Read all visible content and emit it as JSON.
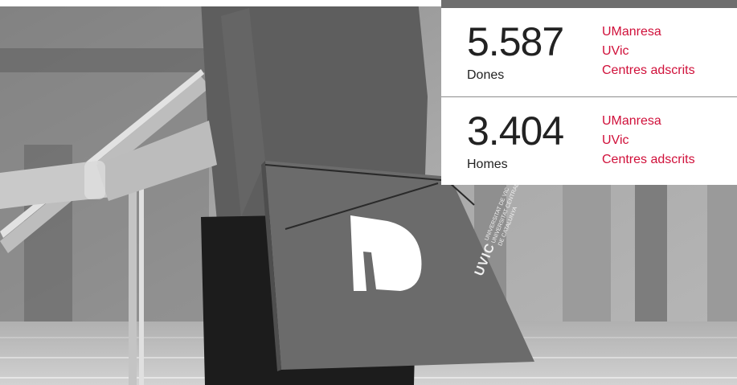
{
  "stats": [
    {
      "number": "5.587",
      "label": "Dones",
      "links": [
        "UManresa",
        "UVic",
        "Centres adscrits"
      ]
    },
    {
      "number": "3.404",
      "label": "Homes",
      "links": [
        "UManresa",
        "UVic",
        "Centres adscrits"
      ]
    }
  ],
  "folder": {
    "brand": "UVIC",
    "line1": "UNIVERSITAT DE VIC",
    "line2": "UNIVERSITAT CENTRAL",
    "line3": "DE CATALUNYA"
  },
  "colors": {
    "link": "#d0103a",
    "text": "#222222",
    "panel_bg": "#ffffff"
  }
}
